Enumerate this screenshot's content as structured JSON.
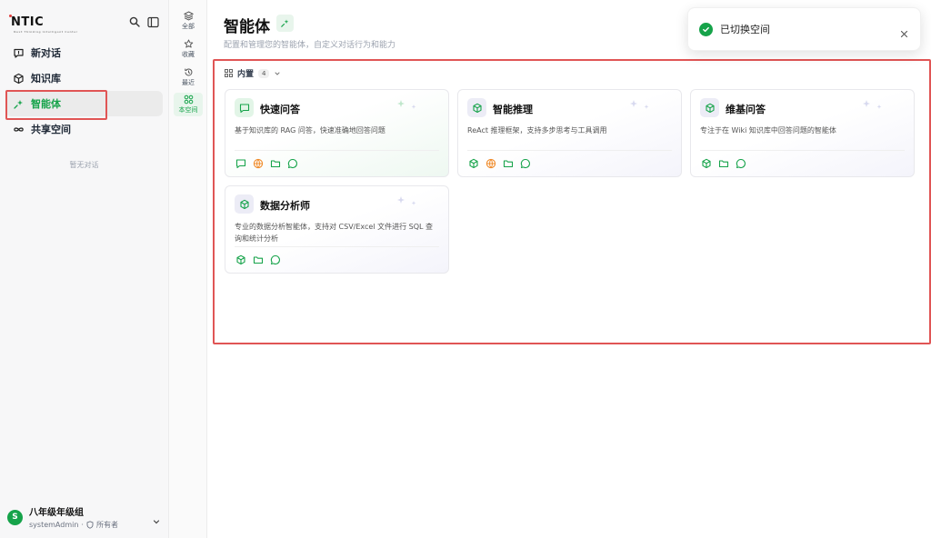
{
  "app": {
    "logo_text": "NTIC",
    "logo_sub": "Next Thinking Intelligent Center"
  },
  "sidebar": {
    "items": [
      {
        "label": "新对话",
        "icon": "new-chat-icon"
      },
      {
        "label": "知识库",
        "icon": "cube-icon"
      },
      {
        "label": "智能体",
        "icon": "sparkle-icon",
        "active": true
      },
      {
        "label": "共享空间",
        "icon": "infinity-icon"
      }
    ],
    "empty_text": "暂无对话",
    "user": {
      "avatar": "S",
      "org": "八年级年级组",
      "name": "systemAdmin",
      "separator": "·",
      "role": "所有者"
    }
  },
  "filters": [
    {
      "label": "全部",
      "icon": "layers-icon"
    },
    {
      "label": "收藏",
      "icon": "star-icon"
    },
    {
      "label": "最近",
      "icon": "history-icon"
    },
    {
      "label": "本空间",
      "icon": "space-icon",
      "active": true
    }
  ],
  "main": {
    "title": "智能体",
    "subtitle": "配置和管理您的智能体，自定义对话行为和能力",
    "section": {
      "label": "内置",
      "count": "4"
    },
    "cards": [
      {
        "title": "快速问答",
        "desc": "基于知识库的 RAG 问答，快速准确地回答问题",
        "tools": [
          "chat-icon",
          "globe-icon",
          "folder-icon",
          "message-icon"
        ]
      },
      {
        "title": "智能推理",
        "desc": "ReAct 推理框架，支持多步思考与工具调用",
        "tools": [
          "cube-icon",
          "globe-icon",
          "folder-icon",
          "message-icon"
        ]
      },
      {
        "title": "维基问答",
        "desc": "专注于在 Wiki 知识库中回答问题的智能体",
        "tools": [
          "cube-icon",
          "folder-icon",
          "message-icon"
        ]
      },
      {
        "title": "数据分析师",
        "desc": "专业的数据分析智能体，支持对 CSV/Excel 文件进行 SQL 查询和统计分析",
        "tools": [
          "cube-icon",
          "folder-icon",
          "message-icon"
        ]
      }
    ]
  },
  "toast": {
    "message": "已切换空间"
  },
  "colors": {
    "accent": "#16a34a",
    "highlight": "#e05555",
    "globe": "#f08c2c"
  }
}
